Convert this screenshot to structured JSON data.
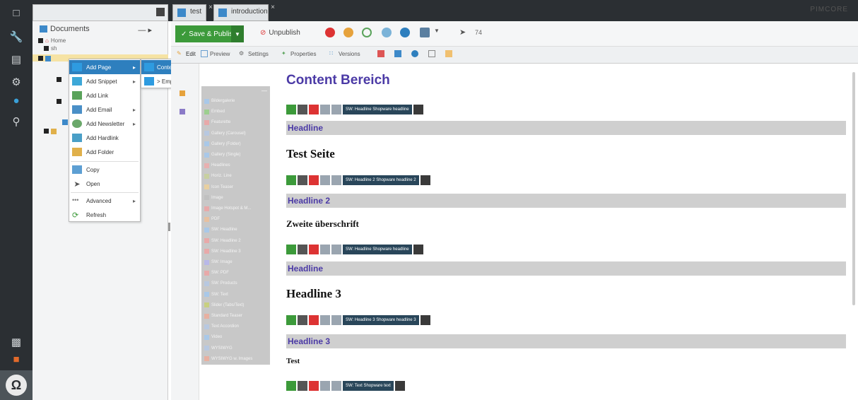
{
  "tabs": [
    {
      "label": "test"
    },
    {
      "label": "introduction"
    }
  ],
  "brand": "PIMCORE",
  "tree": {
    "root_label": "Documents",
    "root_tool": "— ▸",
    "home_label": "Home",
    "sub_label": "sh"
  },
  "context_menu": {
    "items": [
      "Add Page",
      "Add Snippet",
      "Add Link",
      "Add Email",
      "Add Newsletter",
      "Add Hardlink",
      "Add Folder",
      "Copy",
      "Open",
      "Advanced",
      "Refresh"
    ]
  },
  "submenu": {
    "items": [
      "Content-Page",
      "> Empty Page"
    ]
  },
  "toolbar": {
    "save_label": "Save & Publish",
    "unpublish_label": "Unpublish",
    "count": "74"
  },
  "subtabs": [
    "Edit",
    "Preview",
    "Settings",
    "Properties",
    "Versions"
  ],
  "palette": {
    "items": [
      "Bildergalerie",
      "Embed",
      "Featurette",
      "Gallery (Carousel)",
      "Gallery (Folder)",
      "Gallery (Single)",
      "Headlines",
      "Horiz. Line",
      "Icon Teaser",
      "Image",
      "Image Hotspot & M...",
      "PDF",
      "SW: Headline",
      "SW: Headline 2",
      "SW: Headline 3",
      "SW: Image",
      "SW: PDF",
      "SW: Products",
      "SW: Text",
      "Slider (Tabs/Text)",
      "Standard Teaser",
      "Text Accordion",
      "Video",
      "WYSIWYG",
      "WYSIWYG w. Images"
    ]
  },
  "content": {
    "title": "Content Bereich",
    "blocks": [
      {
        "ctrl_label": "SW: Headline Shopware headline",
        "bar_label": "Headline",
        "text": "Test Seite"
      },
      {
        "ctrl_label": "SW: Headline 2 Shopware headline 2",
        "bar_label": "Headline 2",
        "text": "Zweite überschrift"
      },
      {
        "ctrl_label": "SW: Headline Shopware headline",
        "bar_label": "Headline",
        "text": "Headline 3"
      },
      {
        "ctrl_label": "SW: Headline 3 Shopware headline 3",
        "bar_label": "Headline 3",
        "text": "Test"
      },
      {
        "ctrl_label": "SW: Text Shopware text"
      }
    ]
  },
  "colors": {
    "accent": "#2e7fbe",
    "heading": "#4b3aa6",
    "save_green": "#3c9a3a",
    "rail": "#2b2f33"
  }
}
